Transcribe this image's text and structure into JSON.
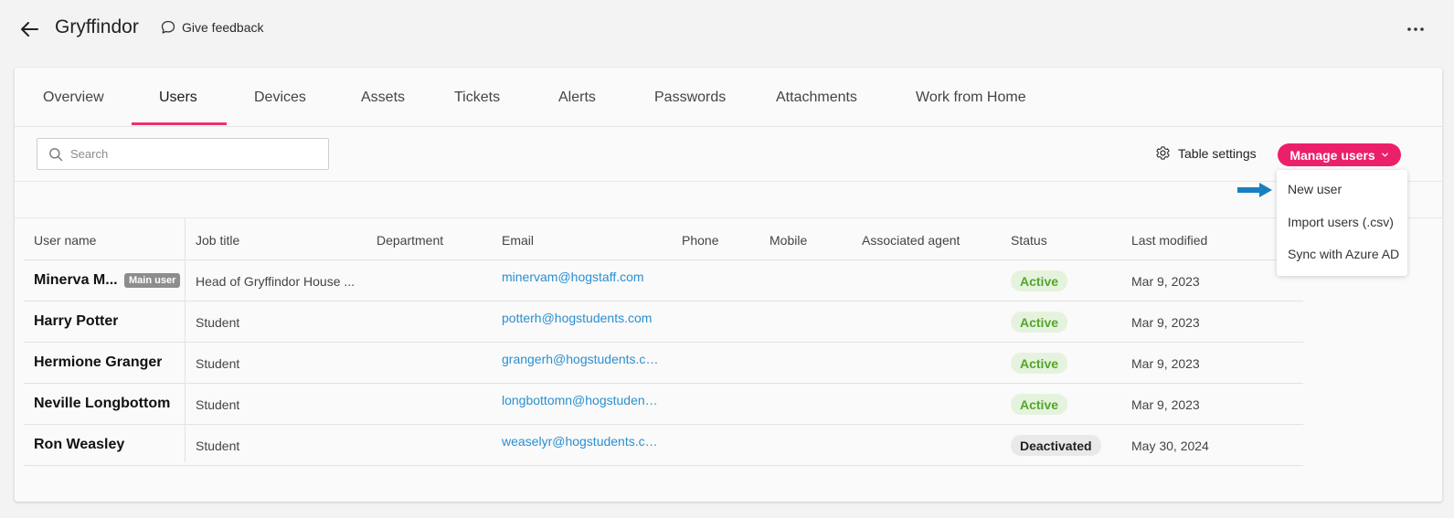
{
  "header": {
    "title": "Gryffindor",
    "feedback_label": "Give feedback"
  },
  "tabs": [
    {
      "label": "Overview"
    },
    {
      "label": "Users"
    },
    {
      "label": "Devices"
    },
    {
      "label": "Assets"
    },
    {
      "label": "Tickets"
    },
    {
      "label": "Alerts"
    },
    {
      "label": "Passwords"
    },
    {
      "label": "Attachments"
    },
    {
      "label": "Work from Home"
    }
  ],
  "active_tab": "Users",
  "toolbar": {
    "search_placeholder": "Search",
    "table_settings_label": "Table settings",
    "manage_users_label": "Manage users"
  },
  "table": {
    "columns": [
      "User name",
      "Job title",
      "Department",
      "Email",
      "Phone",
      "Mobile",
      "Associated agent",
      "Status",
      "Last modified"
    ],
    "rows": [
      {
        "name": "Minerva M...",
        "badge": "Main user",
        "job": "Head of Gryffindor House ...",
        "email": "minervam@hogstaff.com",
        "status": "Active",
        "modified": "Mar 9, 2023"
      },
      {
        "name": "Harry Potter",
        "badge": "",
        "job": "Student",
        "email": "potterh@hogstudents.com",
        "status": "Active",
        "modified": "Mar 9, 2023"
      },
      {
        "name": "Hermione Granger",
        "badge": "",
        "job": "Student",
        "email": "grangerh@hogstudents.co...",
        "status": "Active",
        "modified": "Mar 9, 2023"
      },
      {
        "name": "Neville Longbottom",
        "badge": "",
        "job": "Student",
        "email": "longbottomn@hogstudent...",
        "status": "Active",
        "modified": "Mar 9, 2023"
      },
      {
        "name": "Ron Weasley",
        "badge": "",
        "job": "Student",
        "email": "weaselyr@hogstudents.co...",
        "status": "Deactivated",
        "modified": "May 30, 2024"
      }
    ]
  },
  "dropdown": {
    "items": [
      {
        "label": "New user"
      },
      {
        "label": "Import users (.csv)"
      },
      {
        "label": "Sync with Azure AD"
      }
    ]
  },
  "colors": {
    "accent": "#ec1f6b",
    "tab_underline": "#e8336d",
    "link": "#2a8fd0",
    "active_status_bg": "#e5f3de",
    "active_status_text": "#54a62b",
    "pointer_arrow": "#1a7fc1"
  },
  "icons": {
    "back": "arrow-left-icon",
    "feedback": "speech-bubble-icon",
    "more": "more-horizontal-icon",
    "search": "search-icon",
    "settings": "gear-icon",
    "manage_chevron": "chevron-down-icon",
    "pointer": "arrow-right-icon"
  }
}
